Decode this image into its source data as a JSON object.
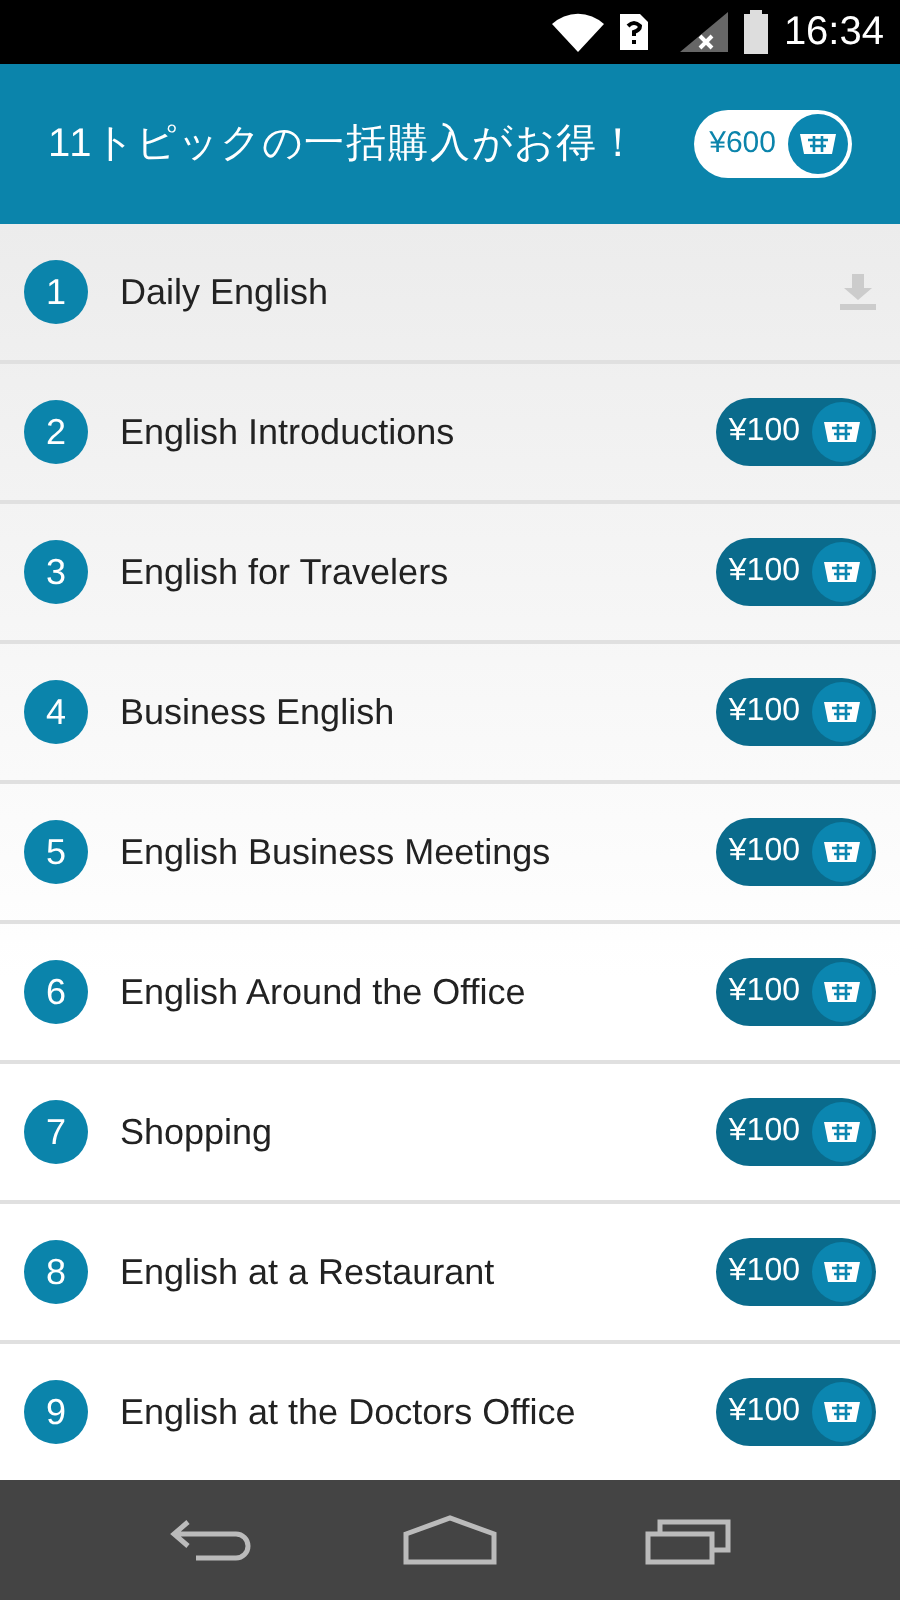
{
  "status_bar": {
    "time": "16:34"
  },
  "header": {
    "title": "11トピックの一括購入がお得！",
    "bundle_price": "¥600"
  },
  "topics": [
    {
      "number": "1",
      "title": "Daily English",
      "kind": "downloaded"
    },
    {
      "number": "2",
      "title": "English Introductions",
      "kind": "purchase",
      "price": "¥100"
    },
    {
      "number": "3",
      "title": "English for Travelers",
      "kind": "purchase",
      "price": "¥100"
    },
    {
      "number": "4",
      "title": "Business English",
      "kind": "purchase",
      "price": "¥100"
    },
    {
      "number": "5",
      "title": "English Business Meetings",
      "kind": "purchase",
      "price": "¥100"
    },
    {
      "number": "6",
      "title": "English Around the Office",
      "kind": "purchase",
      "price": "¥100"
    },
    {
      "number": "7",
      "title": "Shopping",
      "kind": "purchase",
      "price": "¥100"
    },
    {
      "number": "8",
      "title": "English at a Restaurant",
      "kind": "purchase",
      "price": "¥100"
    },
    {
      "number": "9",
      "title": "English at the Doctors Office",
      "kind": "purchase",
      "price": "¥100"
    }
  ]
}
